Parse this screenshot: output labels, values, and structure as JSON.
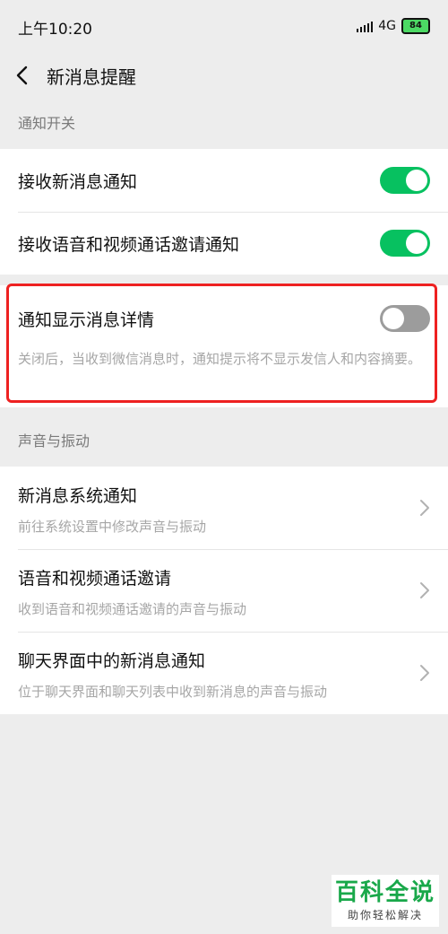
{
  "status_bar": {
    "time": "上午10:20",
    "network": "4G",
    "battery": "84"
  },
  "nav": {
    "title": "新消息提醒",
    "back_icon": "chevron-left-icon"
  },
  "notification_switch": {
    "header": "通知开关",
    "items": [
      {
        "label": "接收新消息通知",
        "enabled": true
      },
      {
        "label": "接收语音和视频通话邀请通知",
        "enabled": true
      }
    ],
    "detail": {
      "label": "通知显示消息详情",
      "enabled": false,
      "description": "关闭后，当收到微信消息时，通知提示将不显示发信人和内容摘要。"
    }
  },
  "sound_vibration": {
    "header": "声音与振动",
    "items": [
      {
        "label": "新消息系统通知",
        "subtitle": "前往系统设置中修改声音与振动"
      },
      {
        "label": "语音和视频通话邀请",
        "subtitle": "收到语音和视频通话邀请的声音与振动"
      },
      {
        "label": "聊天界面中的新消息通知",
        "subtitle": "位于聊天界面和聊天列表中收到新消息的声音与振动"
      }
    ]
  },
  "watermark": {
    "main": "百科全说",
    "sub": "助你轻松解决"
  },
  "colors": {
    "toggle_on": "#07c160",
    "toggle_off": "#9c9c9c",
    "highlight": "#ee2121",
    "watermark": "#19a84a"
  }
}
